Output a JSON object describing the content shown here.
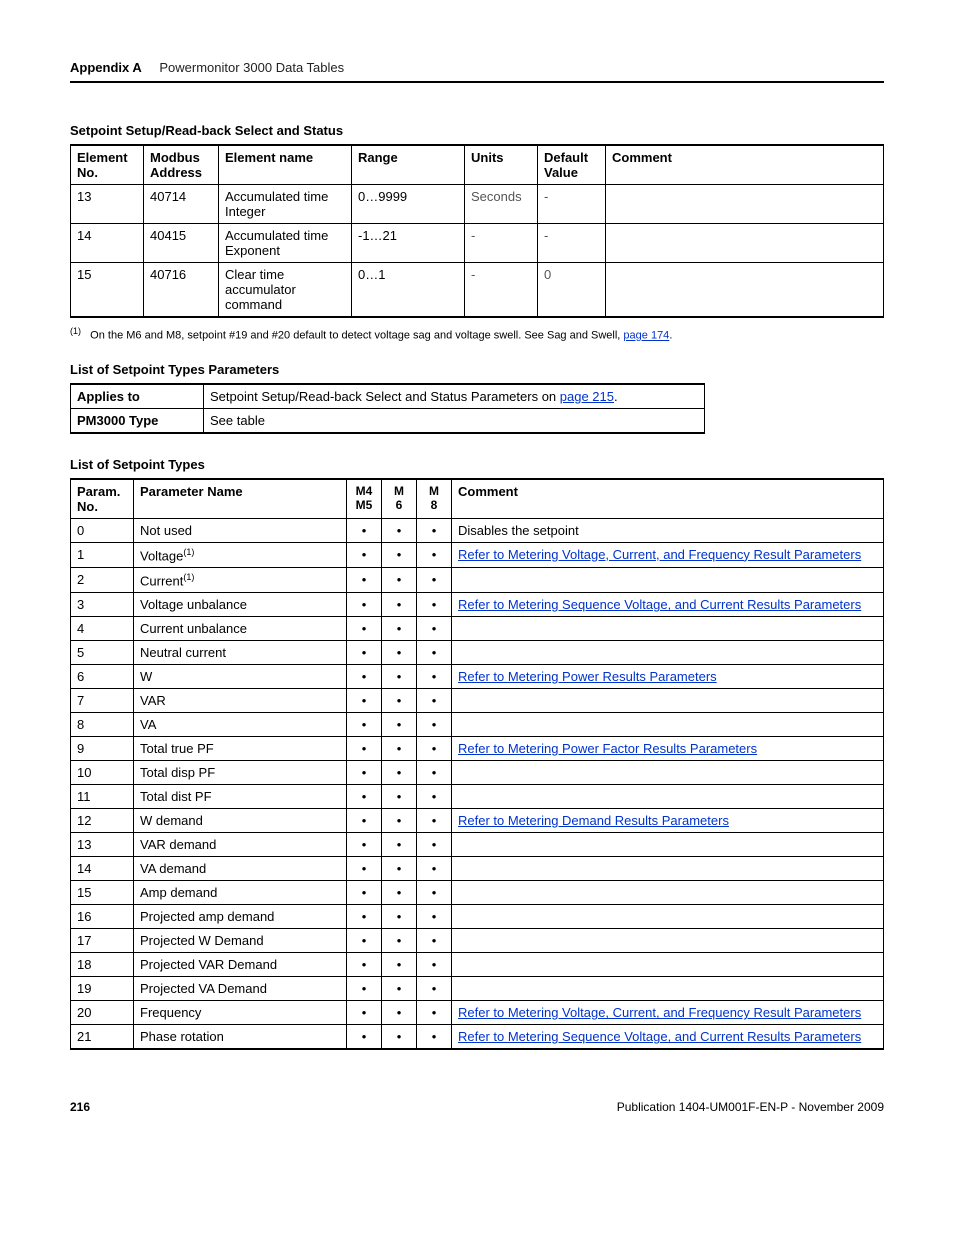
{
  "header": {
    "appendix": "Appendix A",
    "title": "Powermonitor 3000 Data Tables"
  },
  "table1": {
    "title": "Setpoint Setup/Read-back Select and Status",
    "headers": {
      "c1": "Element No.",
      "c2": "Modbus Address",
      "c3": "Element name",
      "c4": "Range",
      "c5": "Units",
      "c6": "Default Value",
      "c7": "Comment"
    },
    "rows": [
      {
        "no": "13",
        "addr": "40714",
        "name": "Accumulated time Integer",
        "range": "0…9999",
        "units": "Seconds",
        "def": "-",
        "comment": ""
      },
      {
        "no": "14",
        "addr": "40415",
        "name": "Accumulated time Exponent",
        "range": "-1…21",
        "units": "-",
        "def": "-",
        "comment": ""
      },
      {
        "no": "15",
        "addr": "40716",
        "name": "Clear time accumulator command",
        "range": "0…1",
        "units": "-",
        "def": "0",
        "comment": ""
      }
    ],
    "footnote_pre": "On the M6 and M8, setpoint #19 and #20 default to detect voltage sag and voltage swell. See Sag and Swell, ",
    "footnote_link": "page 174",
    "footnote_post": "."
  },
  "table2": {
    "title": "List of Setpoint Types Parameters",
    "rows": {
      "r1k": "Applies to",
      "r1v_pre": "Setpoint Setup/Read-back Select and Status Parameters on ",
      "r1v_link": "page 215",
      "r1v_post": ".",
      "r2k": "PM3000 Type",
      "r2v": "See table"
    }
  },
  "table3": {
    "title": "List of Setpoint Types",
    "headers": {
      "c1": "Param. No.",
      "c2": "Parameter Name",
      "c3": "M4 M5",
      "c4": "M6",
      "c5": "M8",
      "c6": "Comment"
    },
    "rows": [
      {
        "no": "0",
        "name": "Not used",
        "sup": "",
        "m45": "•",
        "m6": "•",
        "m8": "•",
        "link": "",
        "comment": "Disables the setpoint"
      },
      {
        "no": "1",
        "name": "Voltage",
        "sup": "(1)",
        "m45": "•",
        "m6": "•",
        "m8": "•",
        "link": "Refer to  Metering Voltage, Current, and Frequency Result Parameters ",
        "comment": ""
      },
      {
        "no": "2",
        "name": "Current",
        "sup": "(1)",
        "m45": "•",
        "m6": "•",
        "m8": "•",
        "link": "",
        "comment": ""
      },
      {
        "no": "3",
        "name": "Voltage unbalance",
        "sup": "",
        "m45": "•",
        "m6": "•",
        "m8": "•",
        "link": "Refer to  Metering Sequence Voltage, and Current Results Parameters ",
        "comment": ""
      },
      {
        "no": "4",
        "name": "Current unbalance",
        "sup": "",
        "m45": "•",
        "m6": "•",
        "m8": "•",
        "link": "",
        "comment": ""
      },
      {
        "no": "5",
        "name": "Neutral current",
        "sup": "",
        "m45": "•",
        "m6": "•",
        "m8": "•",
        "link": "",
        "comment": ""
      },
      {
        "no": "6",
        "name": "W",
        "sup": "",
        "m45": "•",
        "m6": "•",
        "m8": "•",
        "link": "Refer to  Metering Power Results Parameters ",
        "comment": ""
      },
      {
        "no": "7",
        "name": "VAR",
        "sup": "",
        "m45": "•",
        "m6": "•",
        "m8": "•",
        "link": "",
        "comment": ""
      },
      {
        "no": "8",
        "name": "VA",
        "sup": "",
        "m45": "•",
        "m6": "•",
        "m8": "•",
        "link": "",
        "comment": ""
      },
      {
        "no": "9",
        "name": "Total true PF",
        "sup": "",
        "m45": "•",
        "m6": "•",
        "m8": "•",
        "link": "Refer to  Metering Power Factor Results Parameters ",
        "comment": ""
      },
      {
        "no": "10",
        "name": "Total disp PF",
        "sup": "",
        "m45": "•",
        "m6": "•",
        "m8": "•",
        "link": "",
        "comment": ""
      },
      {
        "no": "11",
        "name": "Total dist PF",
        "sup": "",
        "m45": "•",
        "m6": "•",
        "m8": "•",
        "link": "",
        "comment": ""
      },
      {
        "no": "12",
        "name": "W demand",
        "sup": "",
        "m45": "•",
        "m6": "•",
        "m8": "•",
        "link": "Refer to  Metering Demand Results Parameters ",
        "comment": ""
      },
      {
        "no": "13",
        "name": "VAR demand",
        "sup": "",
        "m45": "•",
        "m6": "•",
        "m8": "•",
        "link": "",
        "comment": ""
      },
      {
        "no": "14",
        "name": "VA demand",
        "sup": "",
        "m45": "•",
        "m6": "•",
        "m8": "•",
        "link": "",
        "comment": ""
      },
      {
        "no": "15",
        "name": "Amp demand",
        "sup": "",
        "m45": "•",
        "m6": "•",
        "m8": "•",
        "link": "",
        "comment": ""
      },
      {
        "no": "16",
        "name": "Projected amp demand",
        "sup": "",
        "m45": "•",
        "m6": "•",
        "m8": "•",
        "link": "",
        "comment": ""
      },
      {
        "no": "17",
        "name": "Projected W Demand",
        "sup": "",
        "m45": "•",
        "m6": "•",
        "m8": "•",
        "link": "",
        "comment": ""
      },
      {
        "no": "18",
        "name": "Projected VAR Demand",
        "sup": "",
        "m45": "•",
        "m6": "•",
        "m8": "•",
        "link": "",
        "comment": ""
      },
      {
        "no": "19",
        "name": "Projected VA Demand",
        "sup": "",
        "m45": "•",
        "m6": "•",
        "m8": "•",
        "link": "",
        "comment": ""
      },
      {
        "no": "20",
        "name": "Frequency",
        "sup": "",
        "m45": "•",
        "m6": "•",
        "m8": "•",
        "link": "Refer to  Metering Voltage, Current, and Frequency Result Parameters ",
        "comment": ""
      },
      {
        "no": "21",
        "name": "Phase rotation",
        "sup": "",
        "m45": "•",
        "m6": "•",
        "m8": "•",
        "link": "Refer to  Metering Sequence Voltage, and Current Results Parameters ",
        "comment": ""
      }
    ]
  },
  "footer": {
    "page": "216",
    "pub": "Publication 1404-UM001F-EN-P - November 2009"
  }
}
